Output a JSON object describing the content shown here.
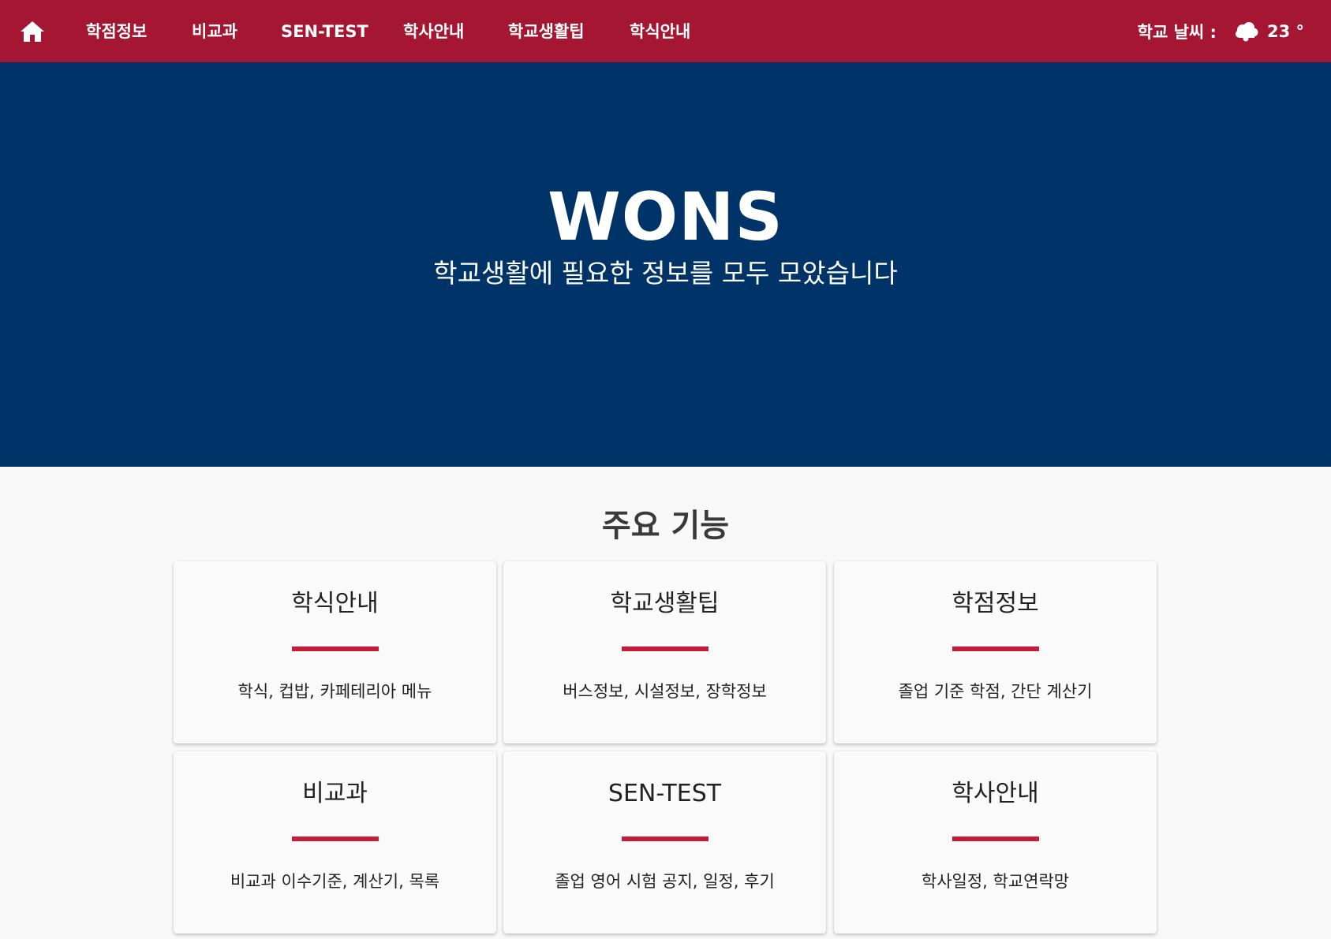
{
  "nav": {
    "home_icon": "home-icon",
    "items": [
      {
        "label": "학점정보"
      },
      {
        "label": "비교과"
      },
      {
        "label": "SEN-TEST"
      },
      {
        "label": "학사안내"
      },
      {
        "label": "학교생활팁"
      },
      {
        "label": "학식안내"
      }
    ],
    "weather": {
      "label": "학교 날씨 :",
      "icon": "cloud-icon",
      "temperature": "23 °"
    }
  },
  "hero": {
    "title": "WONS",
    "subtitle": "학교생활에 필요한 정보를 모두 모았습니다"
  },
  "features": {
    "heading": "주요 기능",
    "cards": [
      {
        "title": "학식안내",
        "description": "학식, 컵밥, 카페테리아 메뉴"
      },
      {
        "title": "학교생활팁",
        "description": "버스정보, 시설정보, 장학정보"
      },
      {
        "title": "학점정보",
        "description": "졸업 기준 학점, 간단 계산기"
      },
      {
        "title": "비교과",
        "description": "비교과 이수기준, 계산기, 목록"
      },
      {
        "title": "SEN-TEST",
        "description": "졸업 영어 시험 공지, 일정, 후기"
      },
      {
        "title": "학사안내",
        "description": "학사일정, 학교연락망"
      }
    ]
  },
  "colors": {
    "nav_bg": "#a41632",
    "hero_bg": "#003468",
    "accent_bar": "#c41d3a",
    "page_bg": "#f8f8f8"
  }
}
